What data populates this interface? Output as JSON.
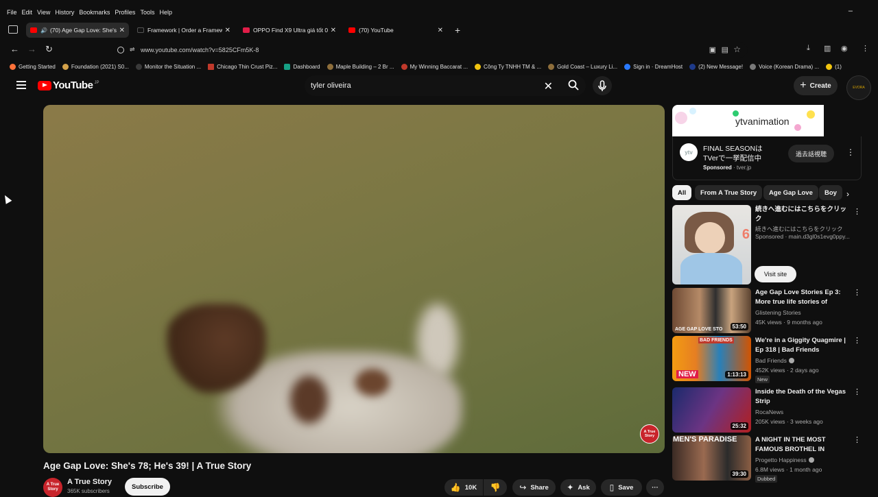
{
  "menu": {
    "items": [
      "File",
      "Edit",
      "View",
      "History",
      "Bookmarks",
      "Profiles",
      "Tools",
      "Help"
    ],
    "minimize": "–"
  },
  "tabs": [
    {
      "title": "(70) Age Gap Love: She's 78; He's 39!",
      "active": true,
      "color": "#ff0000"
    },
    {
      "title": "Framework | Order a Framework Laptop",
      "active": false,
      "color": "#111111"
    },
    {
      "title": "OPPO Find X9 Ultra giá tốt 04/2026",
      "active": false,
      "color": "#e11d48"
    },
    {
      "title": "(70) YouTube",
      "active": false,
      "color": "#ff0000"
    }
  ],
  "tab_close": "✕",
  "new_tab": "+",
  "nav": {
    "back": "←",
    "forward": "→",
    "reload": "↻"
  },
  "url": "www.youtube.com/watch?v=5825CFm5K-8",
  "right_icons": {
    "download": "⤓",
    "sidebar": "▥",
    "profile": "◉",
    "menu": "⋮"
  },
  "bookmarks": [
    {
      "label": "Getting Started",
      "color": "#ff7139"
    },
    {
      "label": "Foundation (2021) S0...",
      "color": "#d4a24a"
    },
    {
      "label": "Monitor the Situation ...",
      "color": "#3a3a3a"
    },
    {
      "label": "Chicago Thin Crust Piz...",
      "color": "#c0392b"
    },
    {
      "label": "Dashboard",
      "color": "#16a085"
    },
    {
      "label": "Maple Building – 2 Br ...",
      "color": "#8e6e3b"
    },
    {
      "label": "My Winning Baccarat ...",
      "color": "#c0392b"
    },
    {
      "label": "Công Ty TNHH TM & ...",
      "color": "#f1c40f"
    },
    {
      "label": "Gold Coast – Luxury Li...",
      "color": "#8e6e3b"
    },
    {
      "label": "Sign in · DreamHost",
      "color": "#2979ff"
    },
    {
      "label": "(2) New Message!",
      "color": "#1e3a8a"
    },
    {
      "label": "Voice (Korean Drama) ...",
      "color": "#7a7a7a"
    },
    {
      "label": "(1)",
      "color": "#f1c40f"
    }
  ],
  "youtube": {
    "logo": "YouTube",
    "country": "JP",
    "search_value": "tyler oliveira",
    "create_label": "Create",
    "avatar_text": "EVORA"
  },
  "video": {
    "title": "Age Gap Love: She's 78; He's 39! | A True Story",
    "watermark": "A True Story",
    "channel": "A True Story",
    "channel_avatar": "A True Story",
    "subscribers": "365K subscribers",
    "subscribe_label": "Subscribe",
    "likes": "10K",
    "share_label": "Share",
    "ask_label": "Ask",
    "save_label": "Save",
    "more": "···"
  },
  "ad": {
    "brand": "ytvanimation",
    "icon_text": "ytv",
    "title": "FINAL SEASONはTVerで一挙配信中",
    "sponsored": "Sponsored",
    "domain": "tver.jp",
    "button": "過去話視聴"
  },
  "chips": [
    "All",
    "From A True Story",
    "Age Gap Love",
    "Boy"
  ],
  "recommendations": [
    {
      "title": "続きへ進むにはこちらをクリック",
      "channel": "続きへ進むにはこちらをクリック",
      "meta": "Sponsored · main.d3gl0s1evg0ppy...",
      "button": "Visit site",
      "thumb_digit": "6"
    },
    {
      "title": "Age Gap Love Stories Ep 3: More true life stories of couple...",
      "channel": "Glistening Stories",
      "meta": "45K views · 9 months ago",
      "duration": "53:50",
      "thumb_text": "AGE GAP LOVE STO"
    },
    {
      "title": "We're in a Giggity Quagmire | Ep 318 | Bad Friends",
      "channel": "Bad Friends",
      "meta": "452K views · 2 days ago",
      "duration": "1:13:13",
      "badge": "New",
      "thumb_text": "BAD FRIENDS",
      "thumb_new": "NEW"
    },
    {
      "title": "Inside the Death of the Vegas Strip",
      "channel": "RocaNews",
      "meta": "205K views · 3 weeks ago",
      "duration": "25:32"
    },
    {
      "title": "A NIGHT IN THE MOST FAMOUS BROTHEL IN EUROP...",
      "channel": "Progetto Happiness",
      "meta": "6.8M views · 1 month ago",
      "duration": "39:30",
      "badge": "Dubbed",
      "thumb_text": "MEN'S PARADISE"
    }
  ]
}
